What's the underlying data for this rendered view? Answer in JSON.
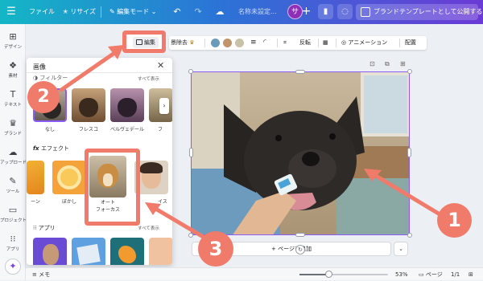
{
  "topbar": {
    "menu_icon": "hamburger-icon",
    "file_label": "ファイル",
    "resize_label": "リサイズ",
    "resize_icon": "star-icon",
    "edit_mode_label": "編集モード",
    "edit_mode_icon": "pencil-icon",
    "undo_icon": "undo-icon",
    "redo_icon": "redo-icon",
    "cloud_icon": "cloud-icon",
    "doc_name_placeholder": "名称未設定...",
    "avatar_letter": "サ",
    "add_icon": "plus-icon",
    "chart_icon": "bar-chart-icon",
    "comment_icon": "comment-icon",
    "publish_label": "ブランドテンプレートとして公開する"
  },
  "rail": {
    "items": [
      {
        "icon": "design-icon",
        "glyph": "⊞",
        "label": "デザイン"
      },
      {
        "icon": "elements-icon",
        "glyph": "❖",
        "label": "素材"
      },
      {
        "icon": "text-icon",
        "glyph": "T",
        "label": "テキスト"
      },
      {
        "icon": "brand-icon",
        "glyph": "♛",
        "label": "ブランド"
      },
      {
        "icon": "upload-icon",
        "glyph": "☁",
        "label": "アップロード"
      },
      {
        "icon": "tools-icon",
        "glyph": "✎",
        "label": "ツール"
      },
      {
        "icon": "projects-icon",
        "glyph": "▭",
        "label": "プロジェクト"
      },
      {
        "icon": "apps-icon",
        "glyph": "⁝⁝",
        "label": "アプリ"
      }
    ],
    "magic_icon": "sparkle-icon"
  },
  "toolbar2": {
    "edit_label": "編集",
    "bg_remove_label": "景除去",
    "colors": [
      "#6a9bb8",
      "#c0956b",
      "#c8c2a8"
    ],
    "flip_label": "反転",
    "animation_label": "アニメーション",
    "arrange_label": "配置"
  },
  "panel": {
    "title": "画像",
    "filter_section": "フィルター",
    "filter_see_all": "すべて表示",
    "filters": [
      {
        "label": "なし"
      },
      {
        "label": "フレスコ"
      },
      {
        "label": "ベルヴェデール"
      },
      {
        "label": "フ"
      }
    ],
    "effect_section": "エフェクト",
    "effects": [
      {
        "label": "ーン"
      },
      {
        "label": "ぼかし"
      },
      {
        "label": "オート\nフォーカス"
      },
      {
        "label": "イス"
      }
    ],
    "apps_section": "アプリ",
    "apps_see_all": "すべて表示"
  },
  "canvas": {
    "lock_icon": "lock-icon",
    "copy_icon": "copy-icon",
    "add_page_icon": "add-page-icon",
    "add_page_label": "+ ページを追加"
  },
  "bottombar": {
    "notes_label": "メモ",
    "zoom_percent": "53%",
    "zoom_fraction": 0.53,
    "pages_label": "ページ",
    "page_count": "1/1"
  },
  "annotations": {
    "badge1": "1",
    "badge2": "2",
    "badge3": "3"
  }
}
